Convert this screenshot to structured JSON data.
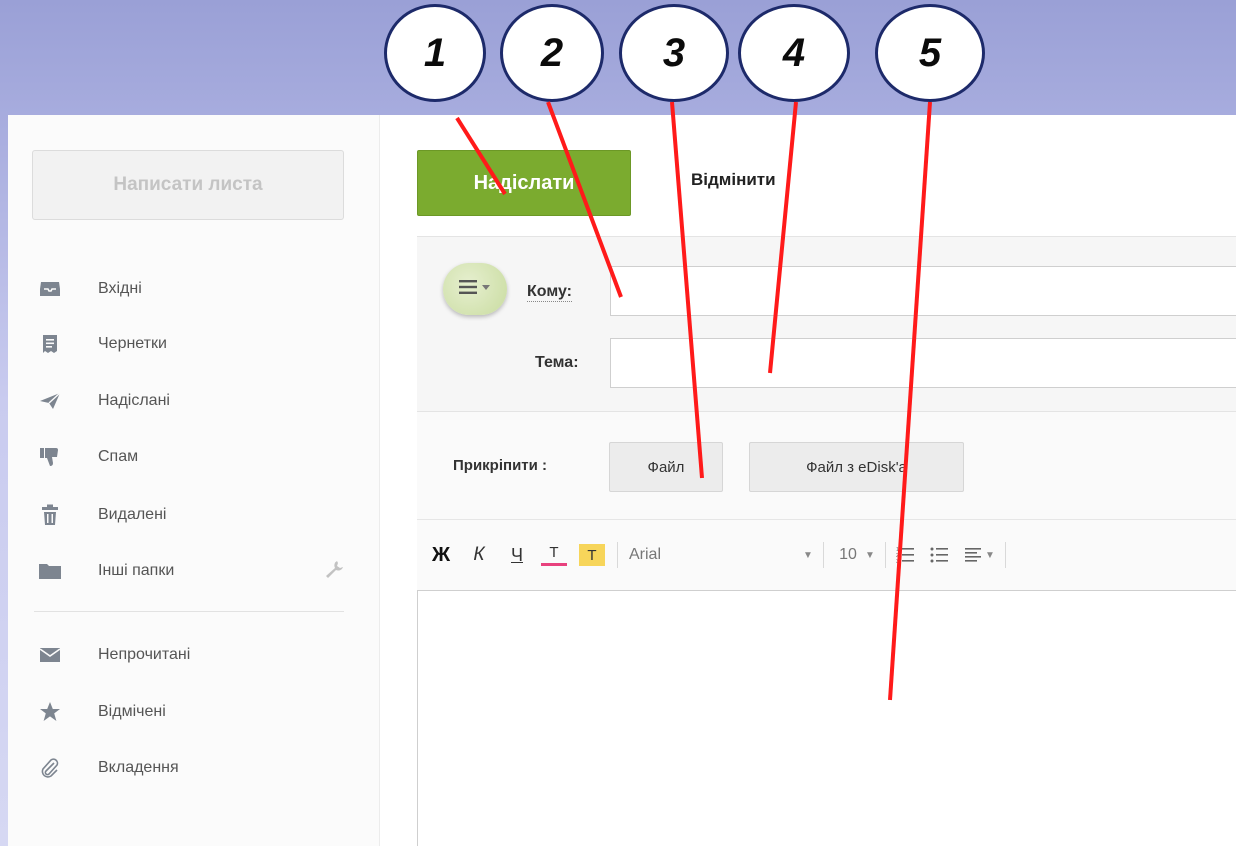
{
  "callouts": [
    "1",
    "2",
    "3",
    "4",
    "5"
  ],
  "sidebar": {
    "compose_label": "Написати листа",
    "folders": [
      {
        "label": "Вхідні",
        "icon": "inbox-icon"
      },
      {
        "label": "Чернетки",
        "icon": "drafts-icon"
      },
      {
        "label": "Надіслані",
        "icon": "sent-icon"
      },
      {
        "label": "Спам",
        "icon": "spam-icon"
      },
      {
        "label": "Видалені",
        "icon": "trash-icon"
      },
      {
        "label": "Інші папки",
        "icon": "folder-icon"
      }
    ],
    "filters": [
      {
        "label": "Непрочитані",
        "icon": "envelope-icon"
      },
      {
        "label": "Відмічені",
        "icon": "star-icon"
      },
      {
        "label": "Вкладення",
        "icon": "paperclip-icon"
      }
    ]
  },
  "compose": {
    "send_label": "Надіслати",
    "cancel_label": "Відмінити",
    "to_label": "Кому:",
    "to_value": "",
    "subject_label": "Тема:",
    "subject_value": "",
    "attach_label": "Прикріпити :",
    "attach_file_label": "Файл",
    "attach_edisk_label": "Файл з eDisk'a"
  },
  "toolbar": {
    "bold": "Ж",
    "italic": "К",
    "underline": "Ч",
    "text_color": "Т",
    "highlight": "Т",
    "font_family": "Arial",
    "font_size": "10"
  },
  "colors": {
    "send_button": "#7bab2f",
    "callout_border": "#1d2a6a",
    "pointer_line": "#ff0000",
    "text_color_underline": "#e8417d",
    "highlight_bg": "#f7d55a"
  }
}
